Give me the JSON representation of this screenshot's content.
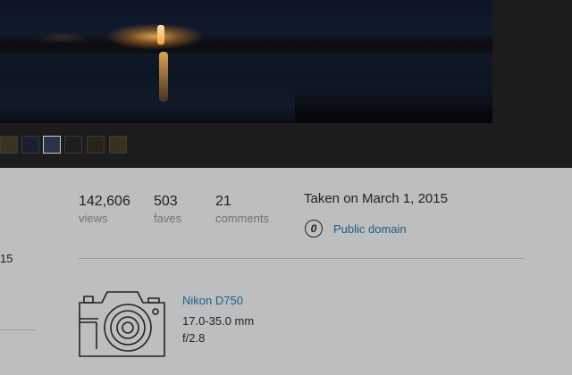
{
  "thumbnails": [
    {
      "id": "t1",
      "color": "#3b3226"
    },
    {
      "id": "t2",
      "color": "#1a1f2e"
    },
    {
      "id": "t3",
      "color": "#2b3548"
    },
    {
      "id": "t4",
      "color": "#1e1e22"
    },
    {
      "id": "t5",
      "color": "#2a2418"
    },
    {
      "id": "t6",
      "color": "#3a3020"
    },
    {
      "id": "t7",
      "color": "#4a3a2a"
    }
  ],
  "stats": {
    "views": {
      "value": "142,606",
      "label": "views"
    },
    "faves": {
      "value": "503",
      "label": "faves"
    },
    "comments": {
      "value": "21",
      "label": "comments"
    }
  },
  "taken": "Taken on March 1, 2015",
  "license": {
    "icon": "0",
    "label": "Public domain"
  },
  "left_partial": "15",
  "camera": {
    "model": "Nikon D750",
    "lens": "17.0-35.0 mm",
    "aperture": "f/2.8"
  },
  "colors": {
    "link": "#1d5d8a",
    "page_bg": "#bdbebf",
    "photo_bg": "#1c1c1d"
  }
}
